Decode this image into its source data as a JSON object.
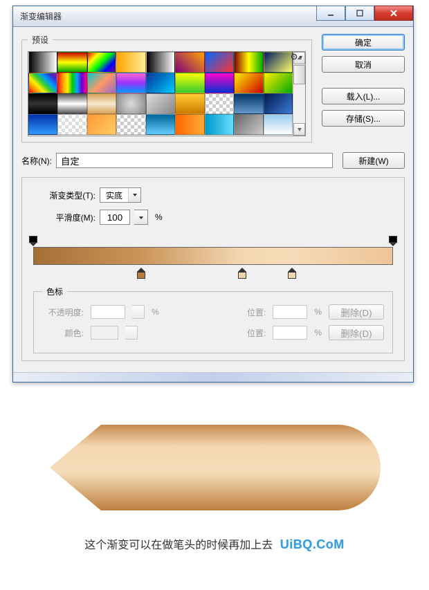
{
  "window": {
    "title": "渐变编辑器"
  },
  "presets": {
    "legend": "预设",
    "swatches": [
      "linear-gradient(to right,#000,#fff)",
      "linear-gradient(to bottom,#c00,#ff0,#0a0)",
      "linear-gradient(135deg,#e00,#ff0,#0f0,#00f,#808)",
      "linear-gradient(to right,#ffa500,#ffeb99)",
      "linear-gradient(to right,#000,transparent)",
      "linear-gradient(45deg,#800080,#ffa500)",
      "linear-gradient(135deg,#0066ff,#ff3333)",
      "linear-gradient(to right,#8b0000,#ff0,#0a0)",
      "linear-gradient(135deg,#001a66,#ffff66)",
      "linear-gradient(45deg,#e00,#ff8800,#ffee00,#33cc33,#0099ff,#3333cc,#aa00aa)",
      "linear-gradient(to right,#ff1a1a,#ff9900,#ffee00,#00cc00,#00aaff,#6600cc,#ff00aa)",
      "linear-gradient(135deg,#00cccc,#ff9966,#9966cc)",
      "linear-gradient(to bottom,#ff66cc,#9933ff,#0099ff)",
      "linear-gradient(135deg,#003399,#00ccff)",
      "linear-gradient(to bottom,#ffff00,#33cc33)",
      "linear-gradient(to bottom,#ff00cc,#0033cc)",
      "linear-gradient(135deg,#ffee00,#cc0000)",
      "linear-gradient(135deg,#ffee00,#00aa00)",
      "linear-gradient(to bottom,#000,#333,#000)",
      "linear-gradient(to bottom,#555,#fff,#555)",
      "linear-gradient(to bottom,#d9a45a,#f5e8d0,#d9a45a)",
      "radial-gradient(circle,#ddd,#888)",
      "linear-gradient(135deg,#dddddd,#888888)",
      "linear-gradient(to bottom,#ffcc33,#cc7a00)",
      "repeating-conic-gradient(#ccc 0 25%,#fff 0 50%)",
      "linear-gradient(to bottom,#003366,#6699cc)",
      "linear-gradient(135deg,#001a4d,#3a7bd5)",
      "linear-gradient(to bottom,#0033aa,#3399ff)",
      "repeating-conic-gradient(#ddd 0 25%,#fff 0 50%)",
      "linear-gradient(135deg,#ff9933,#ffcc66)",
      "repeating-conic-gradient(#ccc 0 25%,#fff 0 50%)",
      "linear-gradient(to bottom,#006699,#66ccff)",
      "linear-gradient(to right,#ff6600,#ffaa33)",
      "linear-gradient(to right,#0099cc,#66ddff)",
      "linear-gradient(135deg,#666,#ccc)",
      "linear-gradient(to bottom,#99ccee,#ffffff)"
    ]
  },
  "buttons": {
    "ok": "确定",
    "cancel": "取消",
    "load": "载入(L)...",
    "save": "存储(S)...",
    "new": "新建(W)"
  },
  "name": {
    "label": "名称(N):",
    "value": "自定"
  },
  "editor": {
    "type_label": "渐变类型(T):",
    "type_value": "实底",
    "smooth_label": "平滑度(M):",
    "smooth_value": "100",
    "percent": "%",
    "gradient_css": "linear-gradient(to right, #a46f35 0%, #cb955a 30%, #f4d7b2 58%, #f7dbb8 72%, #edc497 100%)",
    "opacity_stops": [
      0,
      100
    ],
    "color_stops": [
      {
        "pos": 30,
        "color": "#b87d3e"
      },
      {
        "pos": 58,
        "color": "#f1d2a8"
      },
      {
        "pos": 72,
        "color": "#f3d5b0"
      }
    ]
  },
  "stops": {
    "legend": "色标",
    "opacity_label": "不透明度:",
    "color_label": "颜色:",
    "position_label": "位置:",
    "delete_label": "删除(D)",
    "percent": "%"
  },
  "caption": {
    "text": "这个渐变可以在做笔头的时候再加上去",
    "watermark": "UiBQ.CoM"
  }
}
